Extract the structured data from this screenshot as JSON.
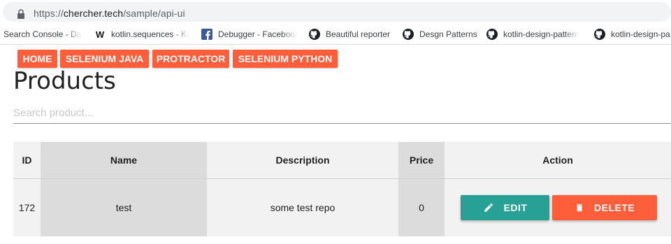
{
  "browser": {
    "url_scheme": "https://",
    "url_host": "chercher.tech",
    "url_path": "/sample/api-ui",
    "bookmarks": [
      {
        "label": "Search Console - Das",
        "icon": "search-console-icon"
      },
      {
        "label": "kotlin.sequences - Ko",
        "icon": "w-icon"
      },
      {
        "label": "Debugger - Facebook",
        "icon": "facebook-icon"
      },
      {
        "label": "Beautiful reporter",
        "icon": "github-icon"
      },
      {
        "label": "Desgn Patterns",
        "icon": "github-icon"
      },
      {
        "label": "kotlin-design-pattern",
        "icon": "github-icon"
      },
      {
        "label": "kotlin-design-pa",
        "icon": "github-icon"
      }
    ]
  },
  "nav": {
    "items": [
      "HOME",
      "SELENIUM JAVA",
      "PROTRACTOR",
      "SELENIUM PYTHON"
    ]
  },
  "page": {
    "title": "Products",
    "search_placeholder": "Search product..."
  },
  "table": {
    "headers": {
      "id": "ID",
      "name": "Name",
      "description": "Description",
      "price": "Price",
      "action": "Action"
    },
    "rows": [
      {
        "id": "172",
        "name": "test",
        "description": "some test repo",
        "price": "0"
      }
    ],
    "edit_label": "EDIT",
    "delete_label": "DELETE"
  },
  "colors": {
    "accent": "#fe5e3a",
    "edit": "#27a195"
  }
}
